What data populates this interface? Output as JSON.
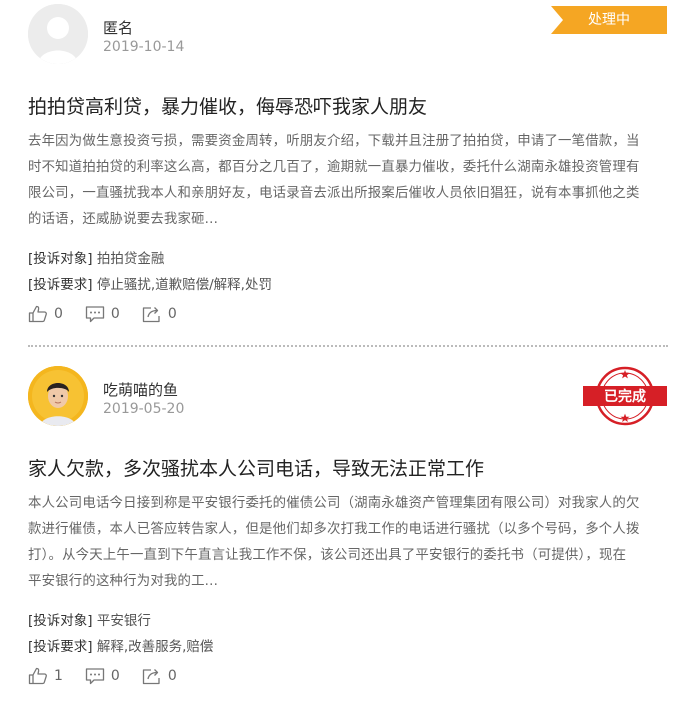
{
  "colors": {
    "processing": "#f5a623",
    "completed": "#d61f26"
  },
  "posts": [
    {
      "user_name": "匿名",
      "date": "2019-10-14",
      "avatar": "default-avatar",
      "status": "处理中",
      "title": "拍拍贷高利贷，暴力催收，侮辱恐吓我家人朋友",
      "body_lines": [
        "去年因为做生意投资亏损，需要资金周转，听朋友介绍，下载并且注册了拍拍贷，申请了一笔借款，当",
        "时不知道拍拍贷的利率这么高，都百分之几百了，逾期就一直暴力催收，委托什么湖南永雄投资管理有",
        "限公司，一直骚扰我本人和亲朋好友，电话录音去派出所报案后催收人员依旧猖狂，说有本事抓他之类",
        "的话语，还威胁说要去我家砸..."
      ],
      "target_label": "[投诉对象]",
      "target_value": "拍拍贷金融",
      "demand_label": "[投诉要求]",
      "demand_value": "停止骚扰,道歉赔偿/解释,处罚",
      "likes": "0",
      "comments": "0",
      "shares": "0"
    },
    {
      "user_name": "吃萌喵的鱼",
      "date": "2019-05-20",
      "avatar": "user-photo-avatar",
      "status": "已完成",
      "title": "家人欠款，多次骚扰本人公司电话，导致无法正常工作",
      "body_lines": [
        "本人公司电话今日接到称是平安银行委托的催债公司（湖南永雄资产管理集团有限公司）对我家人的欠",
        "款进行催债，本人已答应转告家人，但是他们却多次打我工作的电话进行骚扰（以多个号码，多个人拨",
        "打）。从今天上午一直到下午直言让我工作不保，该公司还出具了平安银行的委托书（可提供），现在",
        "平安银行的这种行为对我的工..."
      ],
      "target_label": "[投诉对象]",
      "target_value": "平安银行",
      "demand_label": "[投诉要求]",
      "demand_value": "解释,改善服务,赔偿",
      "likes": "1",
      "comments": "0",
      "shares": "0"
    }
  ],
  "icons": {
    "like": "thumbs-up-icon",
    "comment": "comment-icon",
    "share": "share-icon"
  }
}
